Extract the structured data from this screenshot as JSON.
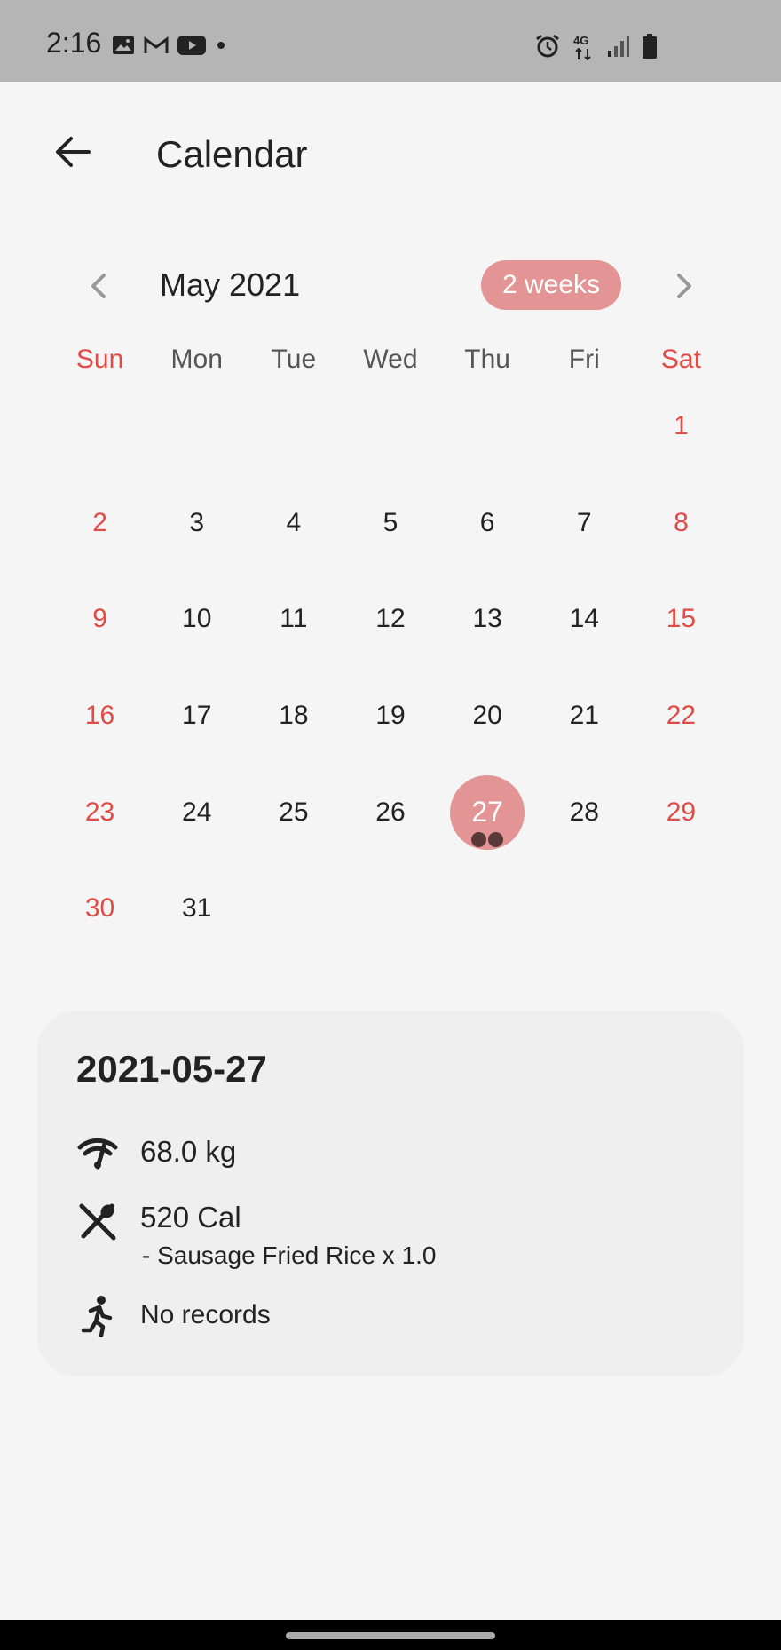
{
  "status_bar": {
    "time": "2:16",
    "network": "4G",
    "left_icons": [
      "image-icon",
      "gmail-icon",
      "youtube-icon",
      "dot-icon"
    ],
    "right_icons": [
      "alarm-icon",
      "network-4g-icon",
      "signal-icon",
      "battery-icon"
    ]
  },
  "appbar": {
    "title": "Calendar"
  },
  "calendar": {
    "month_label": "May 2021",
    "range_chip": "2 weeks",
    "weekdays": [
      "Sun",
      "Mon",
      "Tue",
      "Wed",
      "Thu",
      "Fri",
      "Sat"
    ],
    "leading_blanks": 6,
    "days": [
      "1",
      "2",
      "3",
      "4",
      "5",
      "6",
      "7",
      "8",
      "9",
      "10",
      "11",
      "12",
      "13",
      "14",
      "15",
      "16",
      "17",
      "18",
      "19",
      "20",
      "21",
      "22",
      "23",
      "24",
      "25",
      "26",
      "27",
      "28",
      "29",
      "30",
      "31"
    ],
    "selected_day": "27",
    "marked_day_dots": 2,
    "weekend_color": "#e24b45",
    "accent_color": "#e39494"
  },
  "detail": {
    "date": "2021-05-27",
    "weight": "68.0 kg",
    "calories": "520 Cal",
    "food_item": "- Sausage Fried Rice x 1.0",
    "exercise": "No records"
  }
}
